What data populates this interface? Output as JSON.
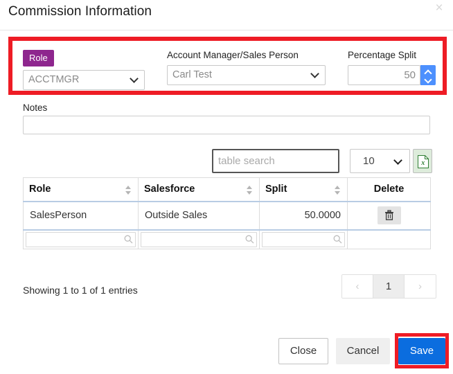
{
  "dialog": {
    "title": "Commission Information",
    "close_icon": "close-icon",
    "close_label": "×"
  },
  "form": {
    "role": {
      "label": "Role",
      "value": "ACCTMGR",
      "caret_icon": "chevron-down-icon",
      "badge_color": "#8e268e"
    },
    "account_manager": {
      "label": "Account Manager/Sales Person",
      "value": "Carl Test",
      "caret_icon": "chevron-down-icon"
    },
    "percentage_split": {
      "label": "Percentage Split",
      "value": "50",
      "up_icon": "chevron-up-icon",
      "down_icon": "chevron-down-icon",
      "spinner_color": "#4d90fe"
    },
    "notes": {
      "label": "Notes",
      "value": "",
      "placeholder": ""
    }
  },
  "toolbar": {
    "search_placeholder": "table search",
    "search_value": "",
    "page_length_value": "10",
    "page_length_caret_icon": "chevron-down-icon",
    "export_icon": "excel-export-icon",
    "export_glyph": "x"
  },
  "table": {
    "columns": [
      {
        "label": "Role",
        "sortable": true,
        "sort_icon": "sort-updown-icon"
      },
      {
        "label": "Salesforce",
        "sortable": true,
        "sort_icon": "sort-updown-icon"
      },
      {
        "label": "Split",
        "sortable": true,
        "sort_icon": "sort-updown-icon"
      },
      {
        "label": "Delete",
        "sortable": false,
        "sort_icon": ""
      }
    ],
    "rows": [
      {
        "role": "SalesPerson",
        "salesforce": "Outside Sales",
        "split": "50.0000",
        "delete_icon": "trash-icon"
      }
    ],
    "filters": [
      {
        "value": "",
        "placeholder": "",
        "icon": "search-icon"
      },
      {
        "value": "",
        "placeholder": "",
        "icon": "search-icon"
      },
      {
        "value": "",
        "placeholder": "",
        "icon": "search-icon"
      }
    ]
  },
  "footer": {
    "info": "Showing 1 to 1 of 1 entries",
    "pagination": {
      "previous_label": "‹",
      "previous_icon": "chevron-left-icon",
      "pages": [
        "1"
      ],
      "active_page": "1",
      "next_label": "›",
      "next_icon": "chevron-right-icon"
    }
  },
  "actions": {
    "close_label": "Close",
    "cancel_label": "Cancel",
    "save_label": "Save",
    "save_color": "#0b6ddf"
  },
  "highlights": {
    "color": "#ee1c25",
    "regions": [
      "commission-fields-row",
      "save-button"
    ]
  }
}
